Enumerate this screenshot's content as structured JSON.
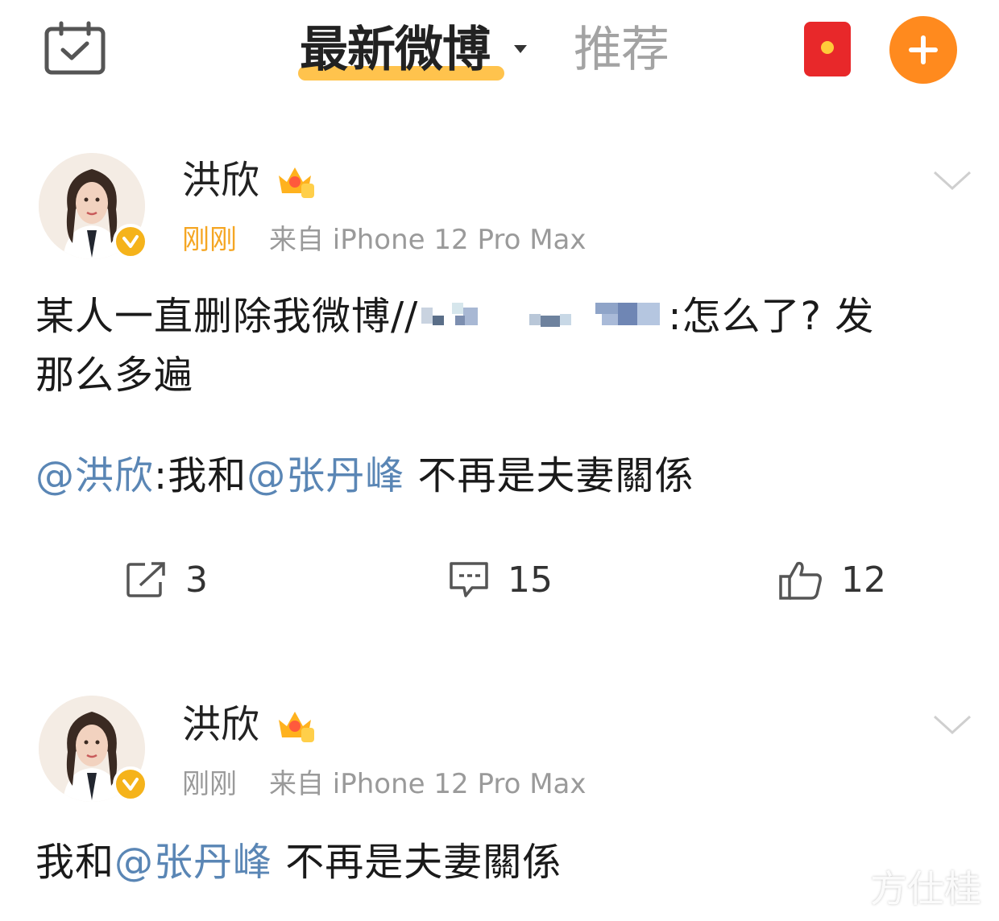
{
  "top_bar": {
    "tab_latest": "最新微博",
    "tab_recommend": "推荐"
  },
  "posts": [
    {
      "username": "洪欣",
      "time": "刚刚",
      "source": "来自 iPhone 12 Pro Max",
      "text_prefix": "某人一直删除我微博//",
      "text_after_blur": ":怎么了? 发",
      "text_line2": "那么多遍",
      "repost_mention": "@洪欣",
      "repost_sep": ":我和",
      "repost_mention2": "@张丹峰",
      "repost_rest": " 不再是夫妻關係",
      "repost_count": "3",
      "comment_count": "15",
      "like_count": "12"
    },
    {
      "username": "洪欣",
      "time": "刚刚",
      "source": "来自 iPhone 12 Pro Max",
      "text_prefix": "我和",
      "text_mention": "@张丹峰",
      "text_rest": " 不再是夫妻關係"
    }
  ],
  "watermark": "方仕桂",
  "colors": {
    "accent_orange": "#ff8a1e",
    "tab_underline": "#ffc34d",
    "mention_blue": "#5a86b5",
    "time_orange": "#f5a623",
    "redpacket": "#e8282a"
  }
}
